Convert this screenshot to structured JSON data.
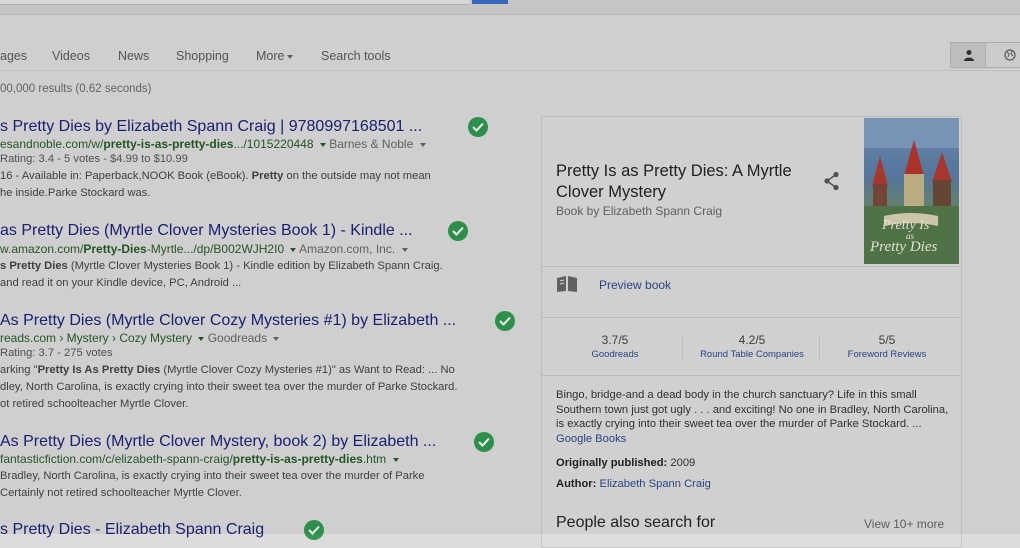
{
  "nav": {
    "tabs": [
      "ages",
      "Videos",
      "News",
      "Shopping",
      "More",
      "Search tools"
    ]
  },
  "stats": "00,000 results (0.62 seconds)",
  "results": [
    {
      "title": "s Pretty Dies by Elizabeth Spann Craig | 9780997168501 ...",
      "url_pre": "esandnoble.com/w/",
      "url_bold": "pretty-is-as-pretty-dies",
      "url_post": ".../1015220448",
      "source": "Barnes & Noble",
      "meta": "Rating: 3.4 - 5 votes - $4.99 to $10.99",
      "snip1_a": "16 - Available in: Paperback,NOOK Book (eBook). ",
      "snip1_b": "Pretty",
      "snip1_c": " on the outside may not mean",
      "snip2": "he inside.Parke Stockard was."
    },
    {
      "title": "as Pretty Dies (Myrtle Clover Mysteries Book 1) - Kindle ...",
      "url_pre": "w.amazon.com/",
      "url_bold": "Pretty-Dies",
      "url_post": "-Myrtle.../dp/B002WJH2I0",
      "source": "Amazon.com, Inc.",
      "snip1_a": "s Pretty Dies",
      "snip1_b": " (Myrtle Clover Mysteries Book 1) - Kindle edition by Elizabeth Spann Craig.",
      "snip2": "and read it on your Kindle device, PC, Android ..."
    },
    {
      "title": "As Pretty Dies (Myrtle Clover Cozy Mysteries #1) by Elizabeth ...",
      "url": "reads.com › Mystery › Cozy Mystery",
      "source": "Goodreads",
      "meta": "Rating: 3.7 - 275 votes",
      "snip1_a": "arking \"",
      "snip1_b": "Pretty Is As Pretty Dies",
      "snip1_c": " (Myrtle Clover Cozy Mysteries #1)\" as Want to Read: ... No",
      "snip2": "dley, North Carolina, is exactly crying into their sweet tea over the murder of Parke Stockard.",
      "snip3": "ot retired schoolteacher Myrtle Clover."
    },
    {
      "title": "As Pretty Dies (Myrtle Clover Mystery, book 2) by Elizabeth ...",
      "url_pre": "fantasticfiction.com/c/elizabeth-spann-craig/",
      "url_bold": "pretty-is-as-pretty-dies",
      "url_post": ".htm",
      "snip1": "Bradley, North Carolina, is exactly crying into their sweet tea over the murder of Parke",
      "snip2": "Certainly not retired schoolteacher Myrtle Clover."
    },
    {
      "title": "s Pretty Dies - Elizabeth Spann Craig"
    }
  ],
  "panel": {
    "title": "Pretty Is as Pretty Dies: A Myrtle Clover Mystery",
    "subtitle": "Book by Elizabeth Spann Craig",
    "cover_text_1": "Pretty Is",
    "cover_text_2": "as",
    "cover_text_3": "Pretty Dies",
    "preview": "Preview book",
    "ratings": [
      {
        "value": "3.7/5",
        "source": "Goodreads"
      },
      {
        "value": "4.2/5",
        "source": "Round Table Companies"
      },
      {
        "value": "5/5",
        "source": "Foreword Reviews"
      }
    ],
    "description": "Bingo, bridge-and a dead body in the church sanctuary? Life in this small Southern town just got ugly . . . and exciting! No one in Bradley, North Carolina, is exactly crying into their sweet tea over the murder of Parke Stockard. ...",
    "description_link": "Google Books",
    "published_label": "Originally published:",
    "published_value": "2009",
    "author_label": "Author:",
    "author_value": "Elizabeth Spann Craig",
    "people_also": "People also search for",
    "view_more": "View 10+ more"
  },
  "colors": {
    "title_link": "#1c237a",
    "url_green": "#275b27",
    "verified_green": "#2f9a4f",
    "panel_link": "#2a4a8a"
  },
  "icons": [
    "verified-check-icon",
    "share-icon",
    "book-preview-icon",
    "account-icon",
    "globe-icon",
    "dropdown-caret-icon"
  ]
}
